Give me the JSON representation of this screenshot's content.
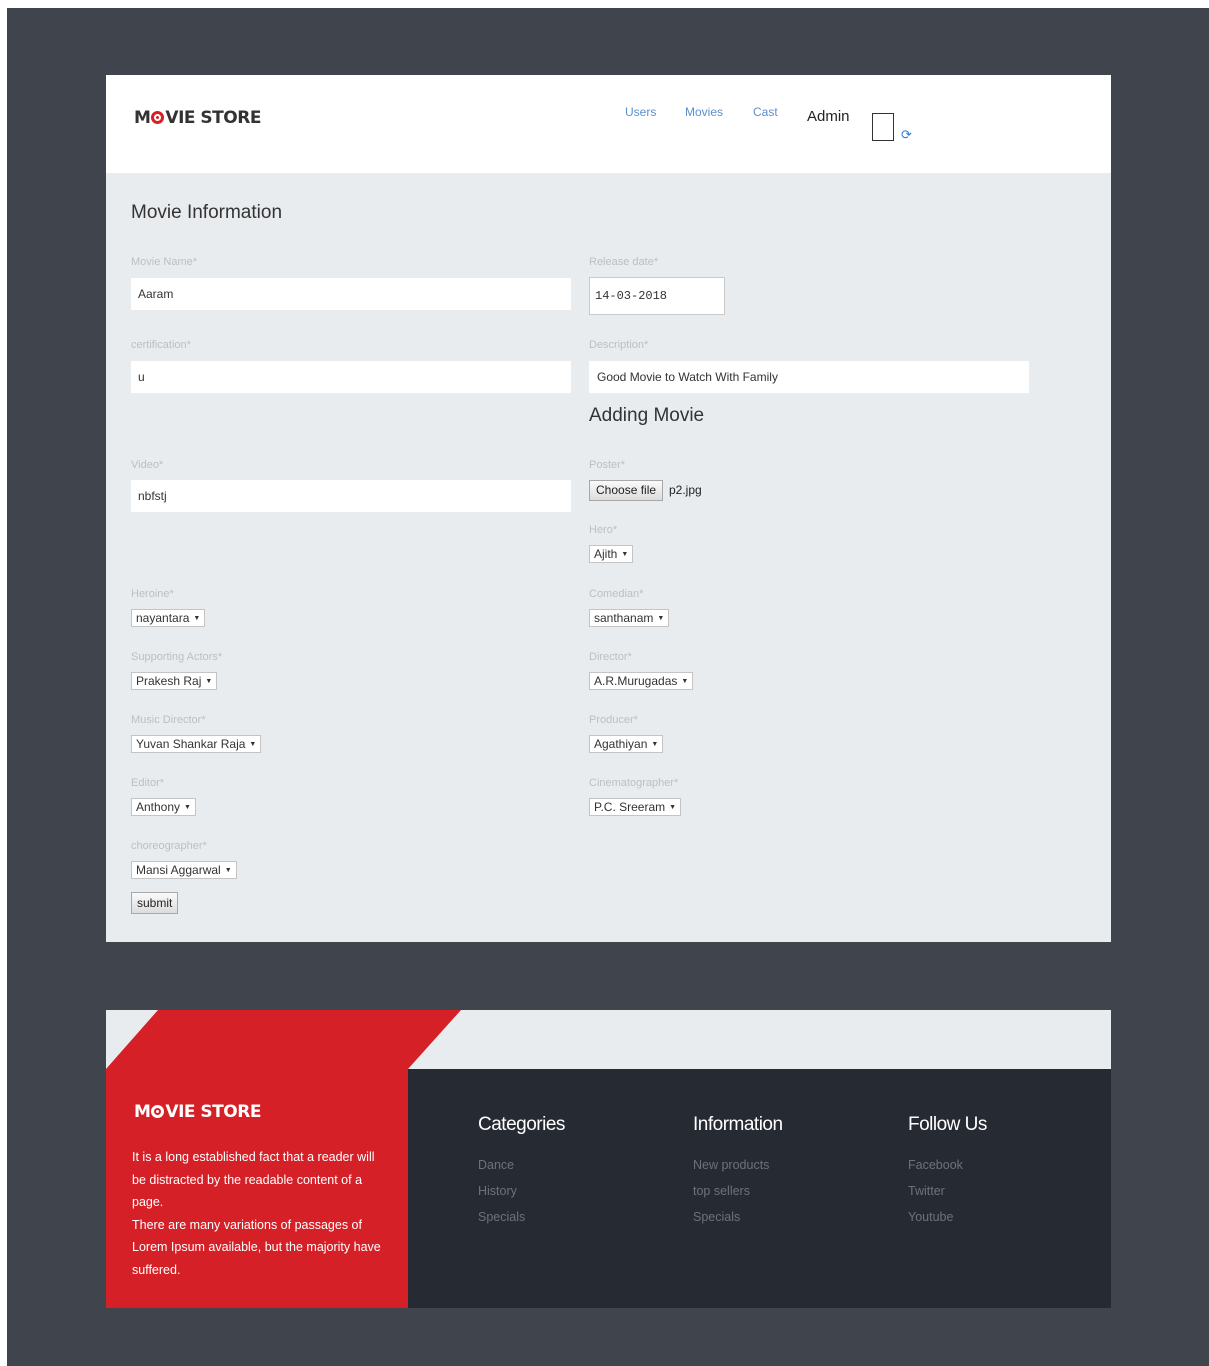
{
  "header": {
    "brand": {
      "part1": "M",
      "part2": "VIE STORE"
    },
    "nav": [
      "Users",
      "Movies",
      "Cast"
    ],
    "user": "Admin"
  },
  "form": {
    "title": "Movie Information",
    "subtitle": "Adding Movie",
    "movie_name": {
      "label": "Movie Name*",
      "value": "Aaram"
    },
    "release_date": {
      "label": "Release date*",
      "value": "14-03-2018"
    },
    "certification": {
      "label": "certification*",
      "value": "u"
    },
    "description": {
      "label": "Description*",
      "value": "Good Movie to Watch With Family"
    },
    "video": {
      "label": "Video*",
      "value": "nbfstj"
    },
    "poster": {
      "label": "Poster*",
      "button": "Choose file",
      "file": "p2.jpg"
    },
    "hero": {
      "label": "Hero*",
      "value": "Ajith"
    },
    "heroine": {
      "label": "Heroine*",
      "value": "nayantara"
    },
    "comedian": {
      "label": "Comedian*",
      "value": "santhanam"
    },
    "supporting": {
      "label": "Supporting Actors*",
      "value": "Prakesh Raj"
    },
    "director": {
      "label": "Director*",
      "value": "A.R.Murugadas"
    },
    "music": {
      "label": "Music Director*",
      "value": "Yuvan Shankar Raja"
    },
    "producer": {
      "label": "Producer*",
      "value": "Agathiyan"
    },
    "editor": {
      "label": "Editor*",
      "value": "Anthony"
    },
    "cinematographer": {
      "label": "Cinematographer*",
      "value": "P.C. Sreeram"
    },
    "choreographer": {
      "label": "choreographer*",
      "value": "Mansi Aggarwal"
    },
    "submit": "submit"
  },
  "footer": {
    "brand": {
      "part1": "M",
      "part2": "VIE STORE"
    },
    "about_1": "It is a long established fact that a reader will be distracted by the readable content of a page.",
    "about_2": "There are many variations of passages of Lorem Ipsum available, but the majority have suffered.",
    "columns": [
      {
        "title": "Categories",
        "links": [
          "Dance",
          "History",
          "Specials"
        ]
      },
      {
        "title": "Information",
        "links": [
          "New products",
          "top sellers",
          "Specials"
        ]
      },
      {
        "title": "Follow Us",
        "links": [
          "Facebook",
          "Twitter",
          "Youtube"
        ]
      }
    ]
  },
  "colors": {
    "brand_red": "#d62027",
    "page_bg": "#40444c",
    "footer_dark": "#262a33",
    "nav_link": "#5b8fcf"
  },
  "icons": {
    "cart": "cart-box-icon",
    "logout": "logout-icon",
    "logo_o": "film-reel-icon"
  }
}
